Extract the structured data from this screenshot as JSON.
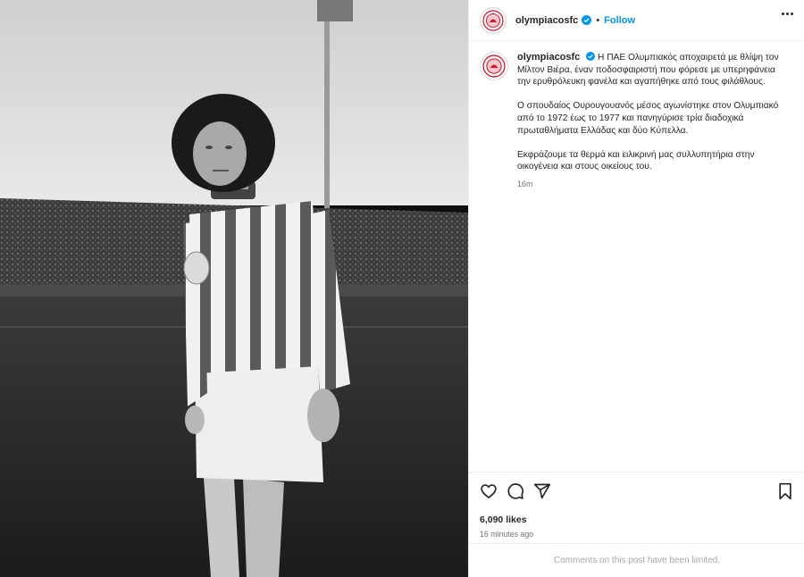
{
  "post": {
    "username": "olympiacosfc",
    "follow_label": "Follow",
    "dot": "•",
    "caption_paragraphs": [
      "Η ΠΑΕ Ολυμπιακός αποχαιρετά με θλίψη τον Μίλτον Βιέρα, έναν ποδοσφαιριστή που φόρεσε με υπερηφάνεια την ερυθρόλευκη φανέλα και αγαπήθηκε από τους φιλάθλους.",
      "Ο σπουδαίος Ουρουγουανός μέσος αγωνίστηκε στον Ολυμπιακό από το 1972 έως το 1977 και πανηγύρισε τρία διαδοχικά πρωταθλήματα Ελλάδας και δύο Κύπελλα.",
      "Εκφράζουμε τα θερμά και ειλικρινή μας συλλυπητήρια στην οικογένεια και στους οικείους του."
    ],
    "caption_time": "16m",
    "likes": "6,090 likes",
    "time_ago": "16 minutes ago",
    "comments_notice": "Comments on this post have been limited."
  },
  "icons": {
    "like": "heart-icon",
    "comment": "comment-icon",
    "share": "send-icon",
    "save": "bookmark-icon",
    "verified": "verified-badge-icon",
    "more": "more-options-icon"
  },
  "colors": {
    "link": "#0095f6",
    "verified": "#0095f6",
    "club_red": "#d7142b",
    "muted": "#737373"
  }
}
